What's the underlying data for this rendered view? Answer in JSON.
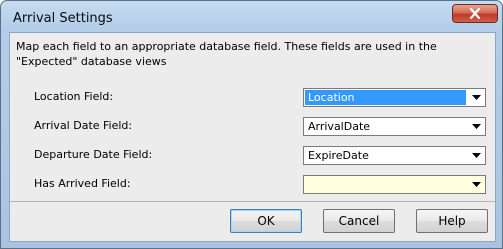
{
  "window": {
    "title": "Arrival Settings",
    "close_icon": "close-icon"
  },
  "description": "Map each field to an appropriate database field.  These fields are used in the \"Expected\" database views",
  "fields": [
    {
      "label": "Location Field:",
      "value": "Location"
    },
    {
      "label": "Arrival Date Field:",
      "value": "ArrivalDate"
    },
    {
      "label": "Departure Date Field:",
      "value": "ExpireDate"
    },
    {
      "label": "Has Arrived Field:",
      "value": ""
    }
  ],
  "buttons": {
    "ok": "OK",
    "cancel": "Cancel",
    "help": "Help"
  },
  "colors": {
    "selection": "#3399ff",
    "empty_field": "#ffffe1",
    "close_button": "#c0392b"
  }
}
